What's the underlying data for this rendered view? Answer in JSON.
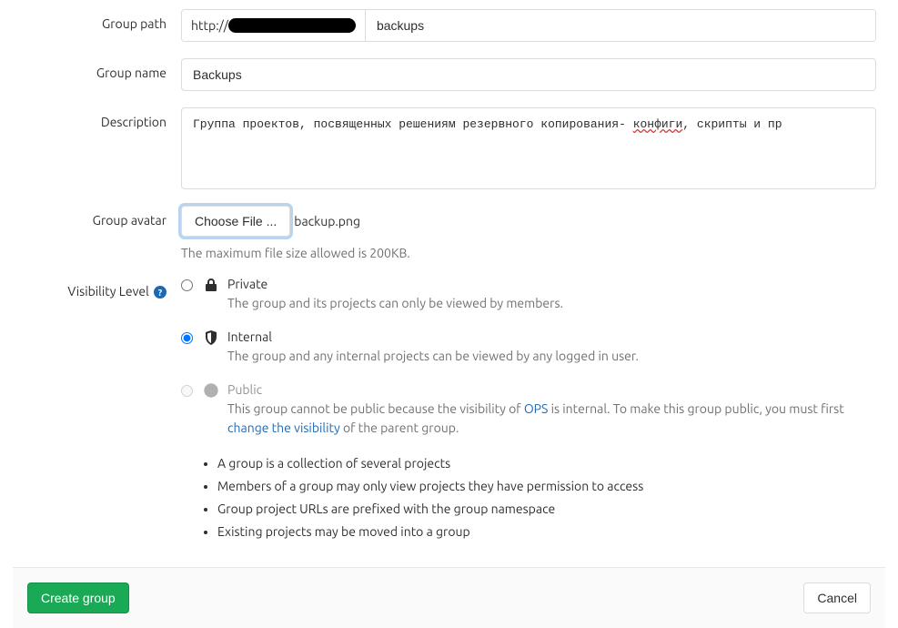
{
  "labels": {
    "group_path": "Group path",
    "group_name": "Group name",
    "description": "Description",
    "group_avatar": "Group avatar",
    "visibility_level": "Visibility Level"
  },
  "group_path": {
    "prefix": "http://",
    "value": "backups"
  },
  "group_name": {
    "value": "Backups"
  },
  "description": {
    "text_before_error": "Группа проектов, посвященных решениям резервного копирования- ",
    "spell_error": "конфиги",
    "text_after_error": ", скрипты и пр"
  },
  "avatar": {
    "button": "Choose File ...",
    "filename": "backup.png",
    "hint": "The maximum file size allowed is 200KB."
  },
  "visibility": {
    "private": {
      "title": "Private",
      "desc": "The group and its projects can only be viewed by members."
    },
    "internal": {
      "title": "Internal",
      "desc": "The group and any internal projects can be viewed by any logged in user."
    },
    "public": {
      "title": "Public",
      "desc_before": "This group cannot be public because the visibility of ",
      "link1": "OPS",
      "desc_mid": " is internal. To make this group public, you must first ",
      "link2": "change the visibility",
      "desc_after": " of the parent group."
    }
  },
  "bullets": {
    "b1": "A group is a collection of several projects",
    "b2": "Members of a group may only view projects they have permission to access",
    "b3": "Group project URLs are prefixed with the group namespace",
    "b4": "Existing projects may be moved into a group"
  },
  "buttons": {
    "create": "Create group",
    "cancel": "Cancel"
  }
}
